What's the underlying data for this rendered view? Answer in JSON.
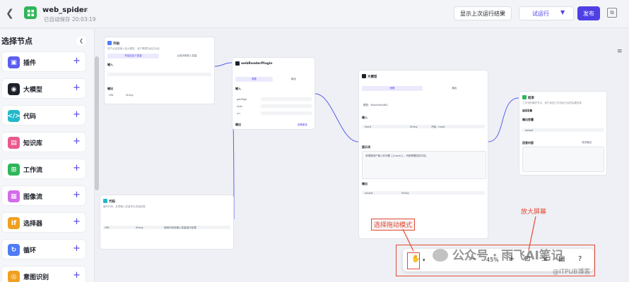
{
  "header": {
    "app_name": "web_spider",
    "save_status": "已自动保存 20:03:19",
    "btn_last_result": "显示上次运行结果",
    "btn_test_run": "试运行",
    "btn_publish": "发布"
  },
  "sidebar": {
    "title": "选择节点",
    "items": [
      {
        "label": "插件",
        "color": "#5b5ef0",
        "glyph": "▣"
      },
      {
        "label": "大模型",
        "color": "#1d2129",
        "glyph": "◉"
      },
      {
        "label": "代码",
        "color": "#23b8c9",
        "glyph": "</>"
      },
      {
        "label": "知识库",
        "color": "#ea5a8c",
        "glyph": "▤"
      },
      {
        "label": "工作流",
        "color": "#2fb65a",
        "glyph": "⊞"
      },
      {
        "label": "图像流",
        "color": "#d36ce8",
        "glyph": "▦"
      },
      {
        "label": "选择器",
        "color": "#f0a020",
        "glyph": "If"
      },
      {
        "label": "循环",
        "color": "#4f7cf5",
        "glyph": "↻"
      },
      {
        "label": "意图识别",
        "color": "#f0a020",
        "glyph": "◎"
      }
    ]
  },
  "canvas": {
    "start_card": {
      "title": "开始",
      "desc": "将节点信息输入给大模型，用户需要先经过对话",
      "tab1": "写给自定义变量",
      "tab2": "从知识库导入变量",
      "sec_input": "输入",
      "sec_output": "输出",
      "field1": "URL",
      "field2": "String"
    },
    "plugin_card": {
      "title": "webReaderPlugin",
      "tab1": "参数",
      "tab2": "输出",
      "sec_input": "输入",
      "p1": "getPage",
      "p2": "type",
      "p3": "url",
      "sec_output": "输出",
      "action": "查看更多"
    },
    "llm_card": {
      "title": "大模型",
      "tab1": "参数",
      "tab2": "输出",
      "model": "模型：Moonshot(8K)",
      "sec_input": "输入",
      "input_name": "input",
      "input_type": "String",
      "input_ref": "开始 - input",
      "sec_prompt": "提示词",
      "prompt_text": "请根据用户输入的问题 {{input}}，判断需要回答内容。",
      "sec_output": "输出",
      "out_name": "output",
      "out_type": "String"
    },
    "end_card": {
      "title": "结束",
      "desc": "工作流的最终节点，用于返回工作流运行后的结果信息",
      "mode": "返回变量",
      "sec_output": "输出变量",
      "out_name": "output",
      "sec_answer": "回答内容",
      "stream": "流式输出"
    },
    "code_card": {
      "title": "代码",
      "desc": "编写代码，处理输入变量来生成返回值",
      "field1": "URL",
      "field2": "String",
      "field3": "使用代码对输入变量进行处理"
    }
  },
  "annotations": {
    "drag_mode": "选择拖动模式",
    "fullscreen": "放大屏幕"
  },
  "toolbar": {
    "zoom": "45%"
  },
  "watermark": {
    "main": "公众号 · 雨飞AI笔记",
    "sub": "@ITPUB博客"
  }
}
